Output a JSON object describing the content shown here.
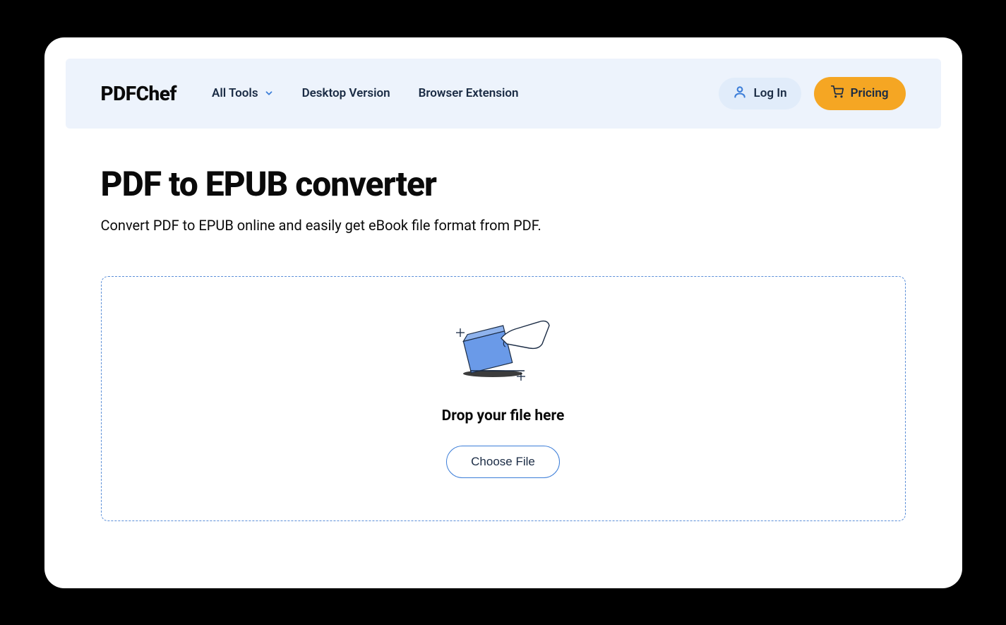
{
  "brand": "PDFChef",
  "nav": {
    "all_tools": "All Tools",
    "desktop_version": "Desktop Version",
    "browser_extension": "Browser Extension"
  },
  "actions": {
    "login": "Log In",
    "pricing": "Pricing"
  },
  "page": {
    "title": "PDF to EPUB converter",
    "subtitle": "Convert PDF to EPUB online and easily get eBook file format from PDF."
  },
  "dropzone": {
    "text": "Drop your file here",
    "button": "Choose File"
  }
}
